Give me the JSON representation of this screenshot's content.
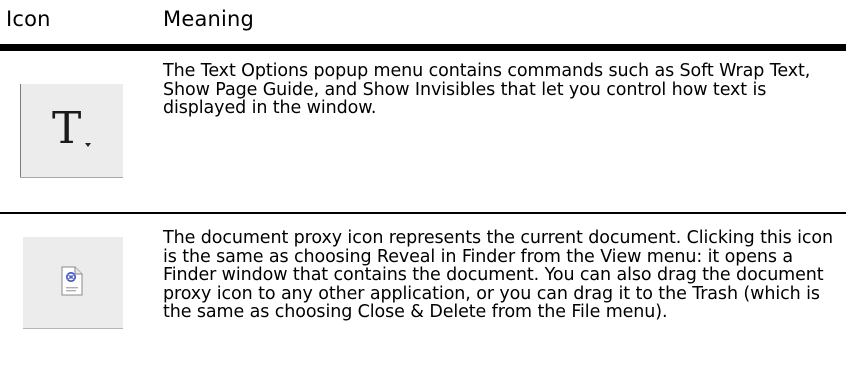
{
  "table": {
    "headers": {
      "icon": "Icon",
      "meaning": "Meaning"
    },
    "rows": [
      {
        "icon_name": "text-options-icon",
        "icon_glyph": "T",
        "meaning": "The Text Options popup menu contains commands such as Soft Wrap Text, Show Page Guide, and Show Invisibles that let you control how text is displayed in the window."
      },
      {
        "icon_name": "document-proxy-icon",
        "meaning": "The document proxy icon represents the current document. Clicking this icon is the same as choosing Reveal in Finder from the View menu: it opens a Finder window that contains the document. You can also drag the document proxy icon to any other application, or you can drag it to the Trash (which is the same as choosing Close & Delete from the File menu)."
      }
    ]
  },
  "colors": {
    "button_bg": "#ececec",
    "rule": "#000000",
    "doc_icon_accent": "#3a4fc2"
  }
}
